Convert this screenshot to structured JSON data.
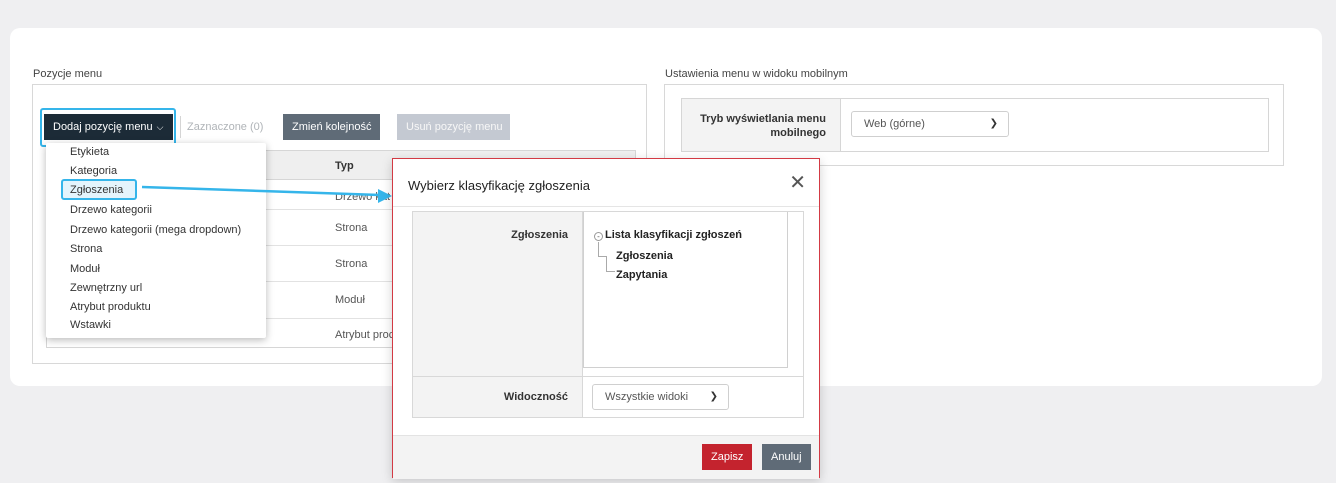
{
  "left_section": {
    "title": "Pozycje menu",
    "toolbar": {
      "add_label": "Dodaj pozycję menu",
      "selected_label": "Zaznaczone (0)",
      "reorder_label": "Zmień kolejność",
      "delete_label": "Usuń pozycję menu"
    },
    "table": {
      "type_header": "Typ",
      "rows": [
        "Drzewo kat",
        "Strona",
        "Strona",
        "Moduł",
        "Atrybut proc"
      ]
    },
    "dropdown": {
      "items": [
        "Etykieta",
        "Kategoria",
        "Zgłoszenia",
        "Drzewo kategorii",
        "Drzewo kategorii (mega dropdown)",
        "Strona",
        "Moduł",
        "Zewnętrzny url",
        "Atrybut produktu",
        "Wstawki"
      ],
      "selected": "Zgłoszenia"
    }
  },
  "right_section": {
    "title": "Ustawienia menu w widoku mobilnym",
    "mobile_mode_label": "Tryb wyświetlania menu mobilnego",
    "mobile_mode_value": "Web (górne)"
  },
  "modal": {
    "title": "Wybierz klasyfikację zgłoszenia",
    "field_label": "Zgłoszenia",
    "tree_root": "Lista klasyfikacji zgłoszeń",
    "tree_children": [
      "Zgłoszenia",
      "Zapytania"
    ],
    "visibility_label": "Widoczność",
    "visibility_value": "Wszystkie widoki",
    "save_label": "Zapisz",
    "cancel_label": "Anuluj"
  },
  "colors": {
    "highlight": "#35b5ea",
    "primary_dark": "#1c2b37",
    "danger": "#c4232e",
    "secondary": "#5f6b77"
  }
}
